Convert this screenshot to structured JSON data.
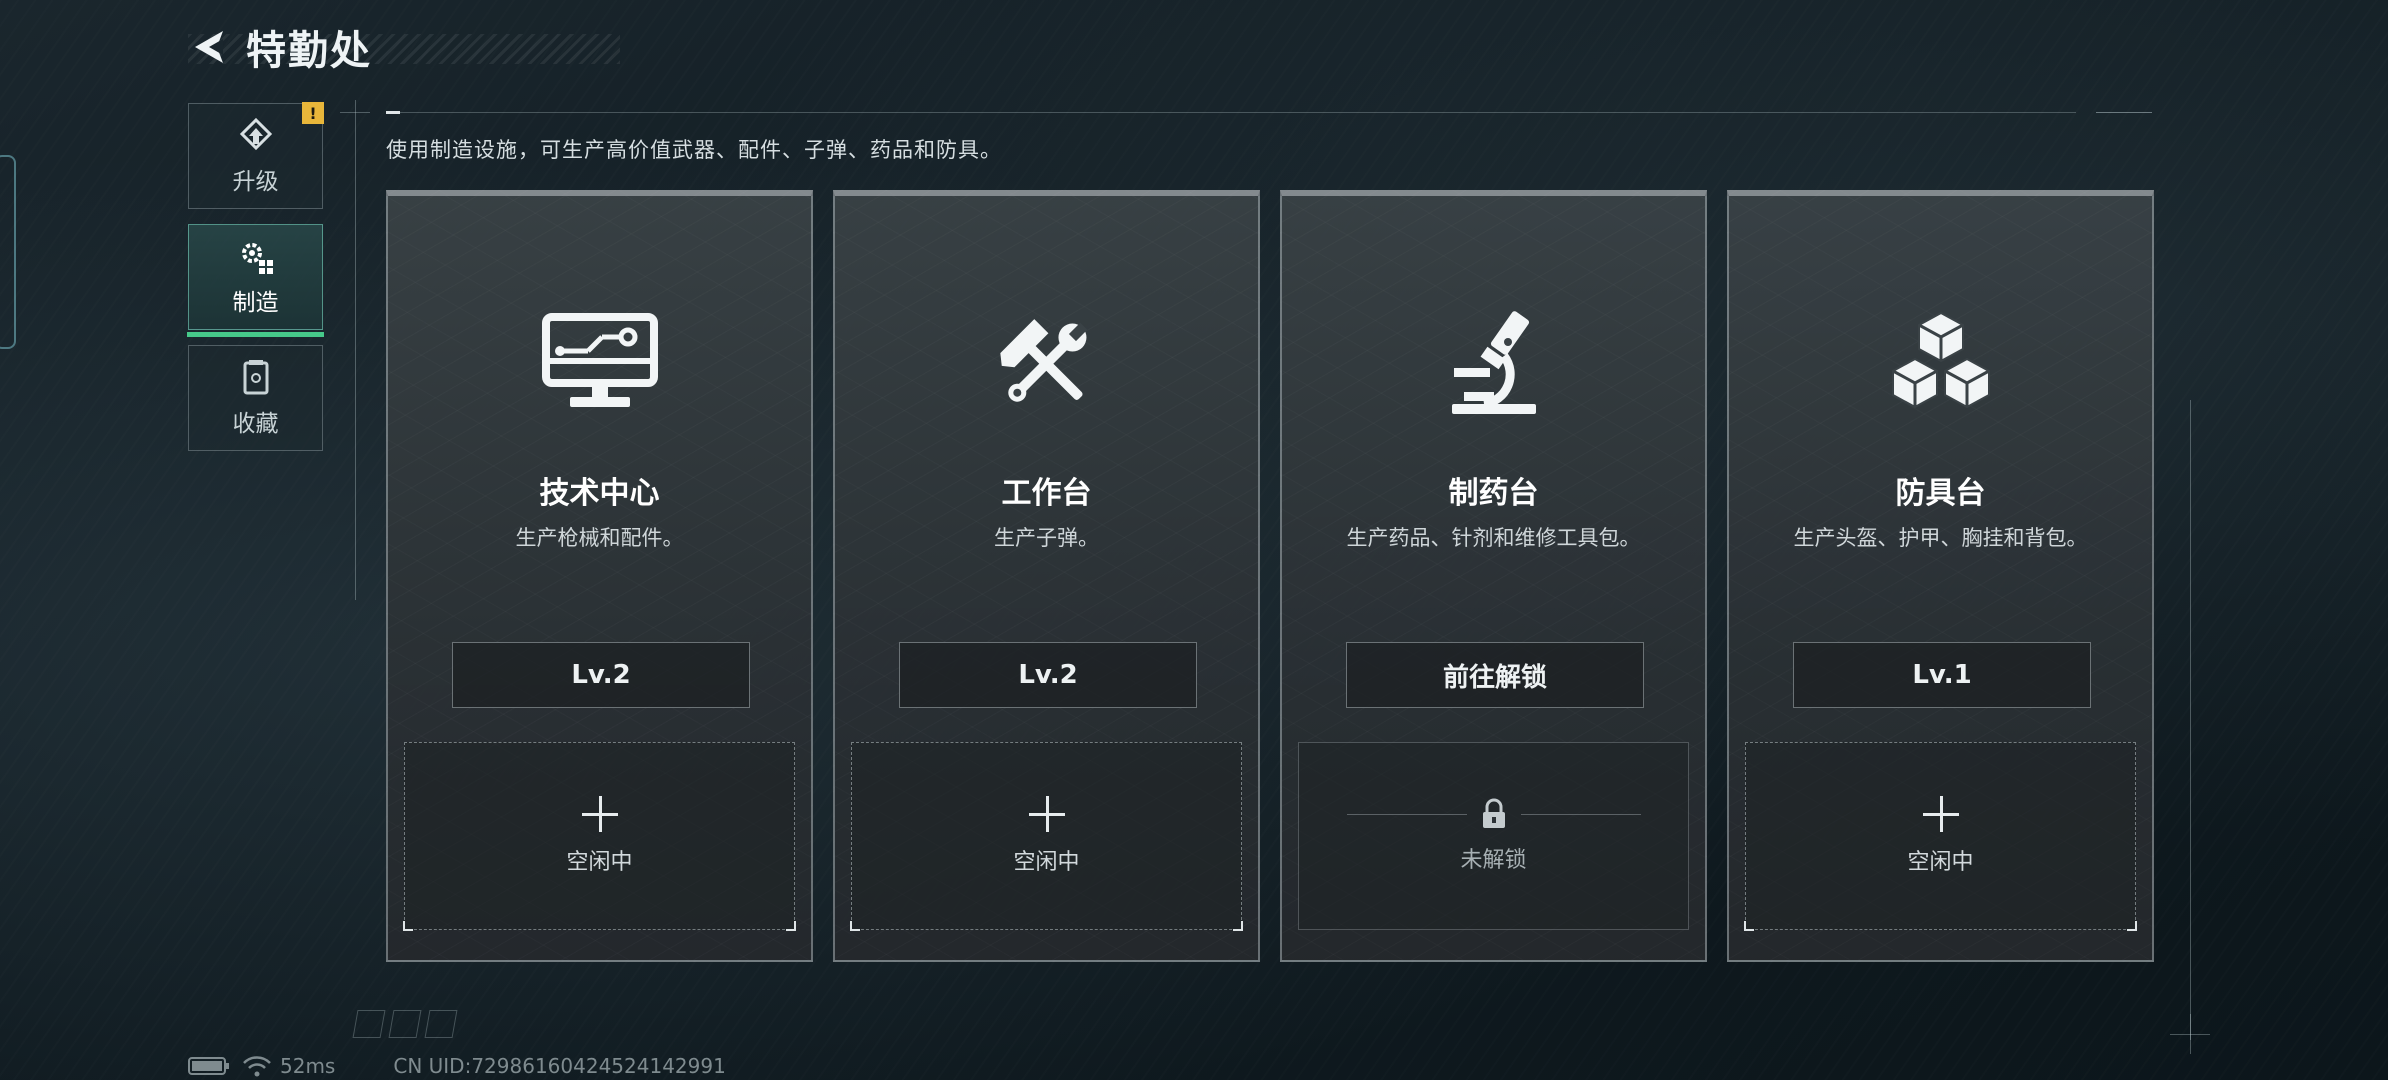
{
  "header": {
    "title": "特勤处",
    "back_icon": "back-arrow-icon"
  },
  "side_nav": {
    "items": [
      {
        "label": "升级",
        "icon": "upgrade-icon",
        "active": false,
        "alert": "!"
      },
      {
        "label": "制造",
        "icon": "gears-icon",
        "active": true
      },
      {
        "label": "收藏",
        "icon": "collection-icon",
        "active": false
      }
    ]
  },
  "description": "使用制造设施，可生产高价值武器、配件、子弹、药品和防具。",
  "cards": [
    {
      "title": "技术中心",
      "subtitle": "生产枪械和配件。",
      "button": "Lv.2",
      "icon": "computer-icon",
      "slot_status": "空闲中",
      "locked": false
    },
    {
      "title": "工作台",
      "subtitle": "生产子弹。",
      "button": "Lv.2",
      "icon": "hammer-wrench-icon",
      "slot_status": "空闲中",
      "locked": false
    },
    {
      "title": "制药台",
      "subtitle": "生产药品、针剂和维修工具包。",
      "button": "前往解锁",
      "icon": "microscope-icon",
      "slot_status": "未解锁",
      "locked": true
    },
    {
      "title": "防具台",
      "subtitle": "生产头盔、护甲、胸挂和背包。",
      "button": "Lv.1",
      "icon": "cubes-icon",
      "slot_status": "空闲中",
      "locked": false
    }
  ],
  "status_bar": {
    "ping": "52ms",
    "uid": "CN UID:72986160424524142991"
  },
  "colors": {
    "accent_green": "#46c98a",
    "alert_yellow": "#e8b63a"
  }
}
